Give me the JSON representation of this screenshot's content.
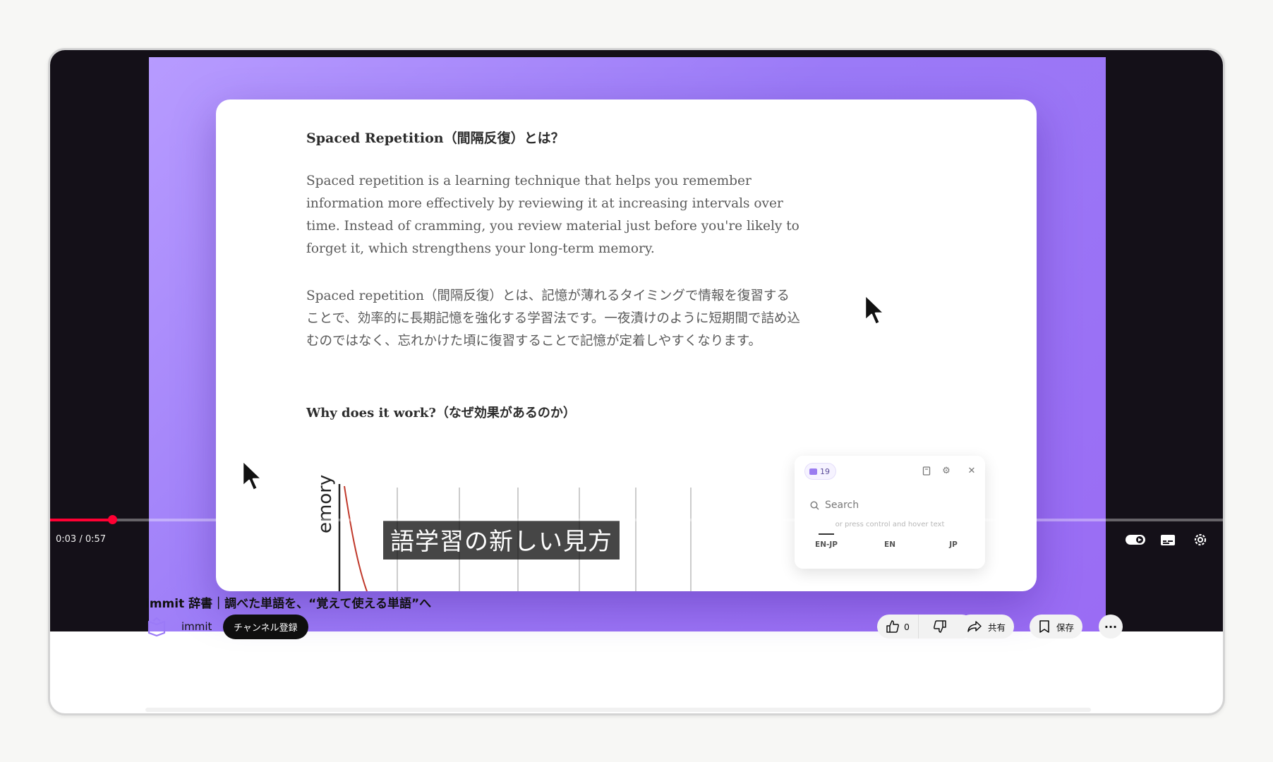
{
  "article": {
    "title": "Spaced Repetition（間隔反復）とは？",
    "paragraph_en": "Spaced repetition is a learning technique that helps you remember information more effectively by reviewing it at increasing intervals over time. Instead of cramming, you review material just before you're likely to forget it, which strengthens your long-term memory.",
    "paragraph_jp": "Spaced repetition（間隔反復）とは、記憶が薄れるタイミングで情報を復習することで、効率的に長期記憶を強化する学習法です。一夜漬けのように短期間で詰め込むのではなく、忘れかけた頃に復習することで記憶が定着しやすくなります。",
    "subheading": "Why does it work?（なぜ効果があるのか）",
    "chart_label": "emory"
  },
  "popup": {
    "count": "19",
    "search_placeholder": "Search",
    "hint": "or press control and hover text",
    "tabs": [
      "EN-JP",
      "EN",
      "JP"
    ],
    "active_tab": "EN-JP"
  },
  "caption": "語学習の新しい見方",
  "player": {
    "time": "0:03 / 0:57",
    "progress": 0.053,
    "accent": "#ff0033"
  },
  "video_info": {
    "title": "immit 辞書｜調べた単語を、“覚えて使える単語”へ",
    "channel": "immit",
    "subscribe_label": "チャンネル登録",
    "like_count": "0",
    "share_label": "共有",
    "save_label": "保存"
  },
  "icons": [
    "like-icon",
    "dislike-icon",
    "share-icon",
    "save-icon",
    "more-icon",
    "autoplay-toggle-icon",
    "subtitles-icon",
    "settings-icon",
    "search-icon",
    "bookmark-icon",
    "gear-icon",
    "close-icon"
  ],
  "colors": {
    "brand_purple": "#9b7af7",
    "subscribe_bg": "#0f0f0f"
  }
}
